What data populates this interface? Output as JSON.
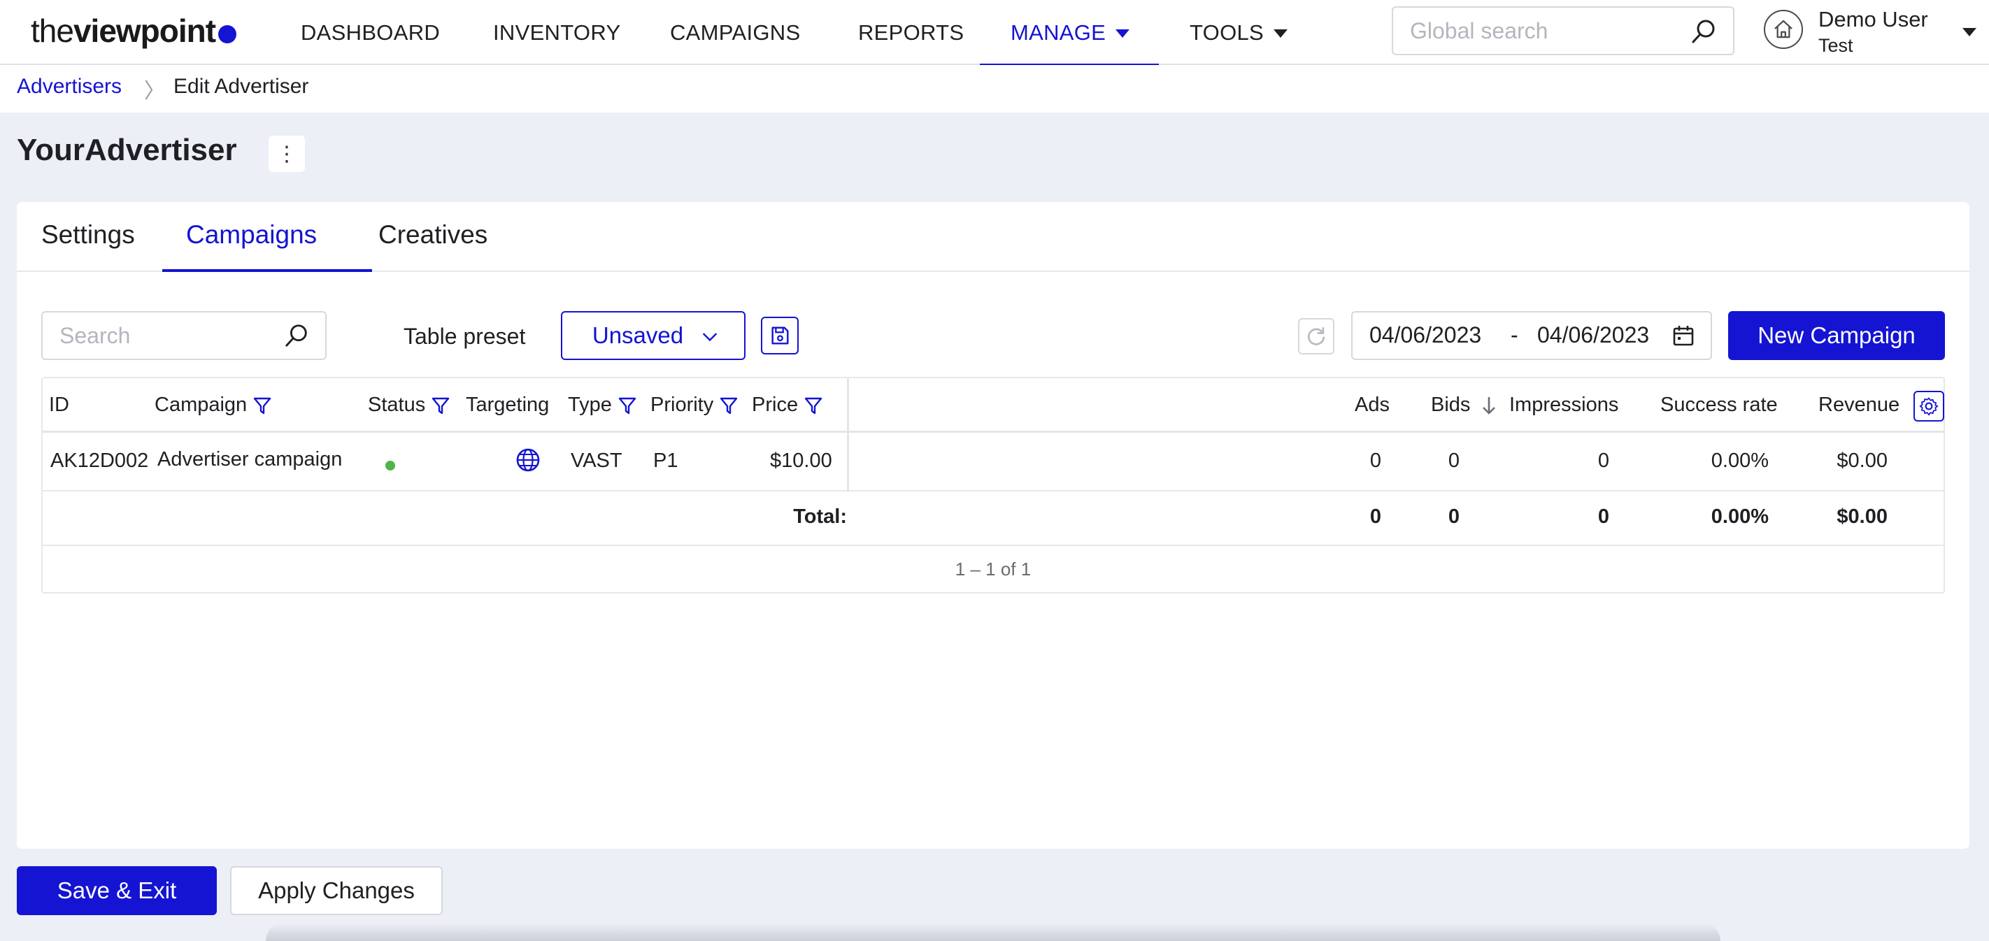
{
  "nav": {
    "logo_light": "the",
    "logo_bold": "viewpoint",
    "items": [
      "DASHBOARD",
      "INVENTORY",
      "CAMPAIGNS",
      "REPORTS",
      "MANAGE",
      "TOOLS"
    ],
    "active": "MANAGE",
    "search_placeholder": "Global search",
    "user_name": "Demo User",
    "user_org": "Test"
  },
  "breadcrumb": {
    "parent": "Advertisers",
    "current": "Edit Advertiser"
  },
  "page": {
    "title": "YourAdvertiser",
    "menu_icon": "kebab-icon"
  },
  "tabs": [
    {
      "label": "Settings",
      "active": false
    },
    {
      "label": "Campaigns",
      "active": true
    },
    {
      "label": "Creatives",
      "active": false
    }
  ],
  "toolbar": {
    "search_placeholder": "Search",
    "preset_label": "Table preset",
    "preset_value": "Unsaved",
    "date_from": "04/06/2023",
    "date_sep": "-",
    "date_to": "04/06/2023",
    "new_button": "New Campaign"
  },
  "table": {
    "columns": [
      "ID",
      "Campaign",
      "Status",
      "Targeting",
      "Type",
      "Priority",
      "Price",
      "Ads",
      "Bids",
      "Impressions",
      "Success rate",
      "Revenue"
    ],
    "rows": [
      {
        "id": "AK12D002",
        "campaign": "Advertiser campaign",
        "status": "active",
        "targeting": "globe-icon",
        "type": "VAST",
        "priority": "P1",
        "price": "$10.00",
        "ads": "0",
        "bids": "0",
        "impressions": "0",
        "success_rate": "0.00%",
        "revenue": "$0.00"
      }
    ],
    "totals": {
      "label": "Total:",
      "ads": "0",
      "bids": "0",
      "impressions": "0",
      "success_rate": "0.00%",
      "revenue": "$0.00"
    },
    "pagination": "1 – 1 of 1"
  },
  "footer": {
    "save_exit": "Save & Exit",
    "apply": "Apply Changes"
  },
  "colors": {
    "accent": "#1414d2",
    "status_active": "#52b34a",
    "page_bg": "#eceff6"
  }
}
